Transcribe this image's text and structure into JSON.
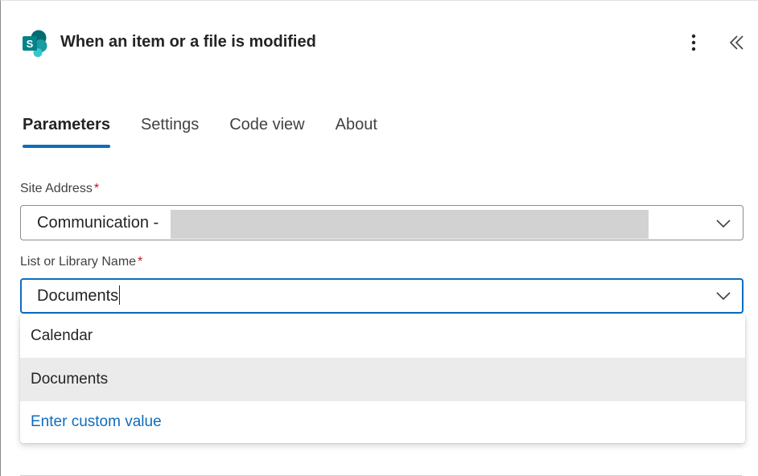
{
  "header": {
    "title": "When an item or a file is modified",
    "logo_icon": "sharepoint-icon",
    "more_icon": "more-vertical-icon",
    "collapse_icon": "double-chevron-left-icon"
  },
  "tabs": [
    {
      "label": "Parameters",
      "active": true
    },
    {
      "label": "Settings",
      "active": false
    },
    {
      "label": "Code view",
      "active": false
    },
    {
      "label": "About",
      "active": false
    }
  ],
  "site_address": {
    "label": "Site Address",
    "required_mark": "*",
    "value": "Communication -"
  },
  "list_name": {
    "label": "List or Library Name",
    "required_mark": "*",
    "value": "Documents"
  },
  "listbox": {
    "options": [
      {
        "label": "Calendar",
        "selected": false
      },
      {
        "label": "Documents",
        "selected": true
      }
    ],
    "custom_label": "Enter custom value"
  },
  "colors": {
    "accent": "#0f6cbd",
    "required": "#c50f1f",
    "selected_bg": "#ebebeb",
    "sharepoint_teal": "#038387"
  }
}
